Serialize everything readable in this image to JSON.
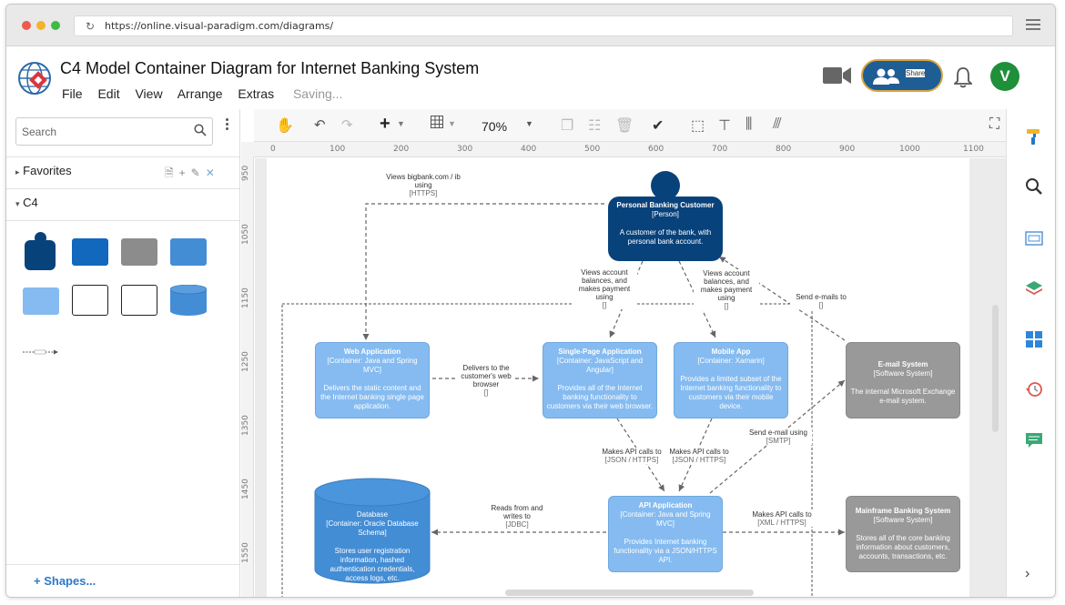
{
  "browser": {
    "url": "https://online.visual-paradigm.com/diagrams/",
    "dots": [
      "#ee5a4f",
      "#f3b42d",
      "#3dbb46"
    ]
  },
  "app": {
    "title": "C4 Model Container Diagram for Internet Banking System",
    "menu": [
      "File",
      "Edit",
      "View",
      "Arrange",
      "Extras"
    ],
    "status": "Saving...",
    "share_label": "Share",
    "avatar_letter": "V",
    "accent": "#1f5d95",
    "avatar_color": "#1f8f3a"
  },
  "sidebar": {
    "search_placeholder": "Search",
    "favorites_label": "Favorites",
    "c4_label": "C4",
    "shapes_label": "+ Shapes..."
  },
  "toolbar": {
    "zoom": "70%"
  },
  "ruler": {
    "h": [
      "0",
      "100",
      "200",
      "300",
      "400",
      "500",
      "600",
      "700",
      "800",
      "900",
      "1000",
      "1100"
    ],
    "v": [
      "950",
      "1050",
      "1150",
      "1250",
      "1350",
      "1450",
      "1550"
    ]
  },
  "diagram": {
    "customer": {
      "title": "Personal Banking Customer",
      "type": "[Person]",
      "desc": "A customer of the bank, with personal bank account."
    },
    "webapp": {
      "title": "Web Application",
      "type": "[Container: Java and Spring MVC]",
      "desc": "Delivers the static content and the Internet banking single page application."
    },
    "spa": {
      "title": "Single-Page Application",
      "type": "[Container: JavaScript and Angular]",
      "desc": "Provides all of the Internet banking functionality to customers via their web browser."
    },
    "mobile": {
      "title": "Mobile App",
      "type": "[Container: Xamarin]",
      "desc": "Provides a limited subset of the Internet banking functionality to customers via their mobile device."
    },
    "email": {
      "title": "E-mail System",
      "type": "[Software System]",
      "desc": "The internal Microsoft Exchange e-mail system."
    },
    "database": {
      "title": "Database",
      "type": "[Container: Oracle Database Schema]",
      "desc": "Stores user registration information, hashed authentication credentials, access logs, etc."
    },
    "api": {
      "title": "API Application",
      "type": "[Container: Java and Spring MVC]",
      "desc": "Provides Internet banking functionality via a JSON/HTTPS API."
    },
    "mainframe": {
      "title": "Mainframe Banking System",
      "type": "[Software System]",
      "desc": "Stores all of the core banking information about customers, accounts, transactions, etc."
    },
    "labels": {
      "views_web": "Views bigbank.com / ib using",
      "views_web_tech": "[HTTPS]",
      "views_spa": "Views account balances, and makes payment using",
      "views_spa_tech": "[]",
      "views_mobile": "Views account balances, and makes payment using",
      "views_mobile_tech": "[]",
      "send_emails": "Send e-mails to",
      "send_emails_tech": "[]",
      "delivers": "Delivers to the customer's web browser",
      "delivers_tech": "[]",
      "api_spa": "Makes API calls to",
      "api_spa_tech": "[JSON / HTTPS]",
      "api_mobile": "Makes API calls to",
      "api_mobile_tech": "[JSON / HTTPS]",
      "send_email_smtp": "Send e-mail using",
      "send_email_smtp_tech": "[SMTP]",
      "reads_writes": "Reads from and writes to",
      "reads_writes_tech": "[JDBC]",
      "api_mainframe": "Makes API calls to",
      "api_mainframe_tech": "[XML / HTTPS]"
    },
    "colors": {
      "person": "#08427b",
      "container": "#85bbf0",
      "container_dark": "#1168bd",
      "database": "#438dd5",
      "external": "#999999"
    }
  }
}
